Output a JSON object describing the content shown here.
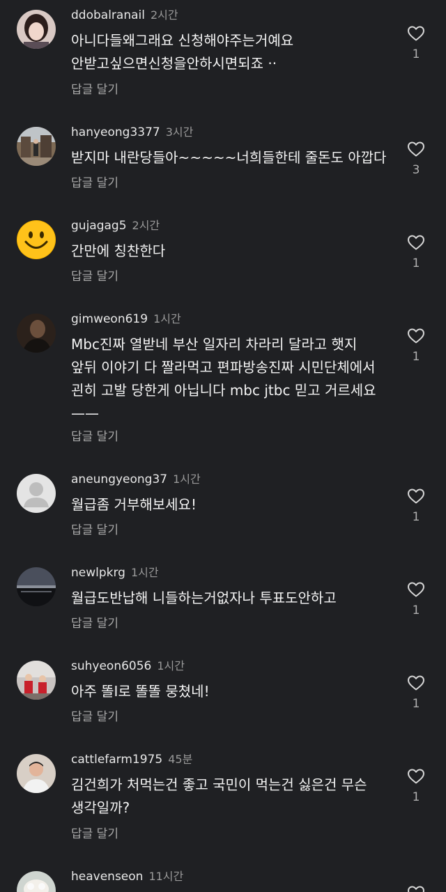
{
  "reply_label": "답글 달기",
  "comments": [
    {
      "username": "ddobalranail",
      "time": "2시간",
      "lines": [
        "아니다들왜그래요 신청해야주는거예요",
        "안받고싶으면신청을안하시면되죠 ··"
      ],
      "likes": "1",
      "avatar": "girl-portrait"
    },
    {
      "username": "hanyeong3377",
      "time": "3시간",
      "lines": [
        "받지마 내란당들아~~~~~너희들한테 줄돈도 아깝다"
      ],
      "likes": "3",
      "avatar": "person-building-photo"
    },
    {
      "username": "gujagag5",
      "time": "2시간",
      "lines": [
        "간만에  칭찬한다"
      ],
      "likes": "1",
      "avatar": "smiley-face"
    },
    {
      "username": "gimweon619",
      "time": "1시간",
      "lines": [
        "Mbc진짜 열받네 부산 일자리 차라리 달라고 햇지",
        "앞뒤 이야기 다 짤라먹고 편파방송진짜 시민단체에서",
        "괸히 고발 당한게 아닙니다 mbc jtbc 믿고 거르세요",
        "——"
      ],
      "likes": "1",
      "avatar": "dark-portrait"
    },
    {
      "username": "aneungyeong37",
      "time": "1시간",
      "lines": [
        "월급좀  거부해보세요!"
      ],
      "likes": "1",
      "avatar": "default-user"
    },
    {
      "username": "newlpkrg",
      "time": "1시간",
      "lines": [
        "월급도반납해 니들하는거없자나 투표도안하고"
      ],
      "likes": "1",
      "avatar": "dark-landscape"
    },
    {
      "username": "suhyeon6056",
      "time": "1시간",
      "lines": [
        "아주 똘I로 똘똘 뭉쳤네!"
      ],
      "likes": "1",
      "avatar": "children-photo"
    },
    {
      "username": "cattlefarm1975",
      "time": "45분",
      "lines": [
        "김건희가 처먹는건 좋고 국민이 먹는건 싫은건 무슨",
        "생각일까?"
      ],
      "likes": "1",
      "avatar": "man-portrait"
    },
    {
      "username": "heavenseon",
      "time": "11시간",
      "lines": [],
      "likes": "",
      "avatar": "sheep-photo"
    }
  ],
  "colors": {
    "background": "#1f2023",
    "text": "#f4f4f4",
    "muted": "#9a9a9a"
  },
  "icons": {
    "like": "heart-outline-icon"
  }
}
